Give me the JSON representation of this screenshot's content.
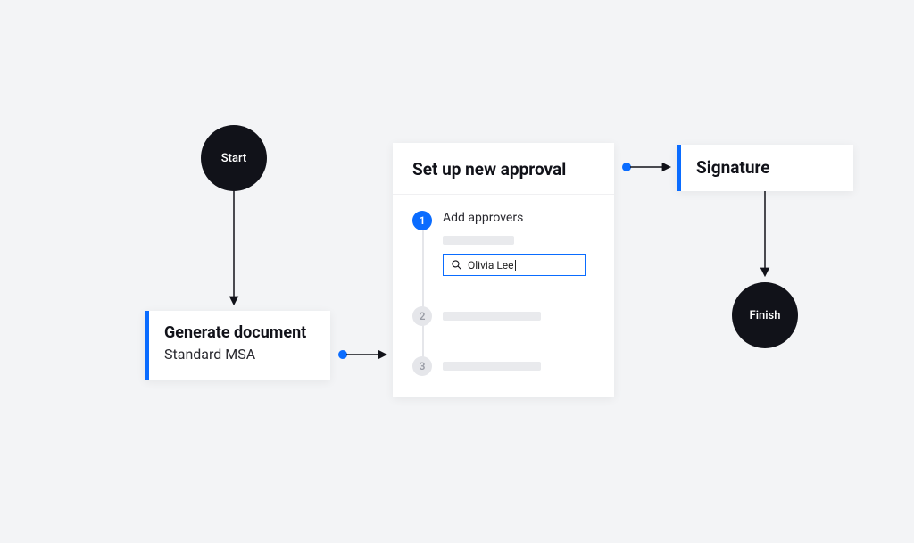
{
  "nodes": {
    "start": {
      "label": "Start"
    },
    "finish": {
      "label": "Finish"
    }
  },
  "generate": {
    "title": "Generate document",
    "subtitle": "Standard MSA"
  },
  "approval": {
    "title": "Set up new approval",
    "step1_label": "Add approvers",
    "search_value": "Olivia Lee",
    "step_numbers": {
      "one": "1",
      "two": "2",
      "three": "3"
    }
  },
  "signature": {
    "title": "Signature"
  },
  "colors": {
    "accent": "#0a6cff",
    "node": "#111219"
  }
}
